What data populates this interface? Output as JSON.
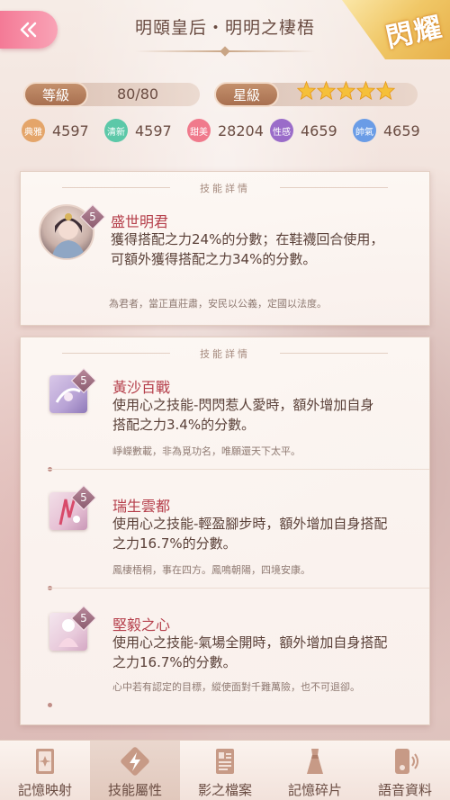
{
  "header": {
    "title": "明頤皇后・明明之棲梧",
    "badge": "閃耀"
  },
  "stats": {
    "level_label": "等級",
    "level_value": "80/80",
    "star_label": "星級",
    "star_count": 5
  },
  "attributes": [
    {
      "label": "典雅",
      "value": "4597",
      "color": "#e4a56a"
    },
    {
      "label": "清新",
      "value": "4597",
      "color": "#5cc8a8"
    },
    {
      "label": "甜美",
      "value": "28204",
      "color": "#f07a8c"
    },
    {
      "label": "性感",
      "value": "4659",
      "color": "#9a6cc9"
    },
    {
      "label": "帥氣",
      "value": "4659",
      "color": "#6a9ce6"
    }
  ],
  "card1": {
    "header": "技能詳情",
    "skill": {
      "level": "5",
      "name": "盛世明君",
      "desc_line1": "獲得搭配之力24%的分數；在鞋襪回合使用，",
      "desc_line2": "可額外獲得搭配之力34%的分數。",
      "flavor": "為君者，當正直莊肅，安民以公義，定國以法度。"
    }
  },
  "card2": {
    "header": "技能詳情",
    "skills": [
      {
        "level": "5",
        "name": "黃沙百戰",
        "desc_line1": "使用心之技能-閃閃惹人愛時，額外增加自身",
        "desc_line2": "搭配之力3.4%的分數。",
        "flavor": "崢嶸數載，非為覓功名，唯願還天下太平。"
      },
      {
        "level": "5",
        "name": "瑞生雲都",
        "desc_line1": "使用心之技能-輕盈腳步時，額外增加自身搭配",
        "desc_line2": "之力16.7%的分數。",
        "flavor": "鳳棲梧桐，事在四方。鳳鳴朝陽，四境安康。"
      },
      {
        "level": "5",
        "name": "堅毅之心",
        "desc_line1": "使用心之技能-氣場全開時，額外增加自身搭配",
        "desc_line2": "之力16.7%的分數。",
        "flavor": "心中若有認定的目標，縱使面對千難萬險，也不可退卻。"
      }
    ]
  },
  "bottom_nav": [
    {
      "label": "記憶映射",
      "icon": "card-icon"
    },
    {
      "label": "技能屬性",
      "icon": "lightning-icon",
      "active": true
    },
    {
      "label": "影之檔案",
      "icon": "document-icon"
    },
    {
      "label": "記憶碎片",
      "icon": "dress-icon"
    },
    {
      "label": "語音資料",
      "icon": "phone-speaker-icon"
    }
  ]
}
